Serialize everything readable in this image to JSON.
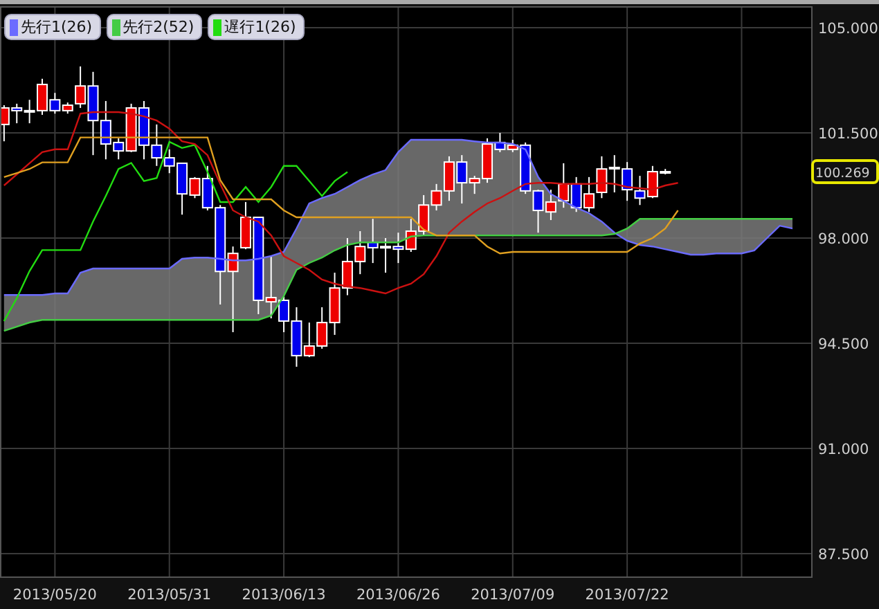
{
  "current_price": "100.269",
  "chart_data": {
    "type": "candlestick",
    "ylim": [
      86.72,
      105.69
    ],
    "categories": [
      null,
      null,
      null,
      null,
      "2013/05/20",
      null,
      null,
      null,
      null,
      null,
      null,
      null,
      null,
      "2013/05/31",
      null,
      null,
      null,
      null,
      null,
      null,
      null,
      null,
      "2013/06/13",
      null,
      null,
      null,
      null,
      null,
      null,
      null,
      null,
      "2013/06/26",
      null,
      null,
      null,
      null,
      null,
      null,
      null,
      null,
      "2013/07/09",
      null,
      null,
      null,
      null,
      null,
      null,
      null,
      null,
      "2013/07/22",
      null,
      null,
      null,
      null,
      null,
      null,
      null,
      null,
      null,
      null,
      null,
      null,
      null
    ],
    "grid": true,
    "yticks": [
      {
        "value": 105,
        "label": "105.000"
      },
      {
        "value": 101.5,
        "label": "101.500"
      },
      {
        "value": 98,
        "label": "98.000"
      },
      {
        "value": 94.5,
        "label": "94.500"
      },
      {
        "value": 91,
        "label": "91.000"
      },
      {
        "value": 87.5,
        "label": "87.500"
      }
    ],
    "series": [
      {
        "name": "先行1(26)",
        "type": "line",
        "color": "#6b6bff",
        "values": [
          96.11,
          96.11,
          96.11,
          96.11,
          96.16,
          96.16,
          96.85,
          96.99,
          96.99,
          96.99,
          96.99,
          96.99,
          96.99,
          96.99,
          97.31,
          97.35,
          97.35,
          97.31,
          97.26,
          97.26,
          97.31,
          97.4,
          97.54,
          98.32,
          99.15,
          99.33,
          99.47,
          99.7,
          99.93,
          100.12,
          100.26,
          100.86,
          101.27,
          101.27,
          101.27,
          101.27,
          101.27,
          101.22,
          101.18,
          101.18,
          101.13,
          100.95,
          100.03,
          99.47,
          99.24,
          99.01,
          98.83,
          98.55,
          98.18,
          97.91,
          97.77,
          97.72,
          97.63,
          97.54,
          97.45,
          97.45,
          97.49,
          97.49,
          97.49,
          97.59,
          98.0,
          98.41,
          98.32
        ]
      },
      {
        "name": "先行2(52)",
        "type": "line",
        "color": "#44cc44",
        "values": [
          94.91,
          95.05,
          95.19,
          95.28,
          95.28,
          95.28,
          95.28,
          95.28,
          95.28,
          95.28,
          95.28,
          95.28,
          95.28,
          95.28,
          95.28,
          95.28,
          95.28,
          95.28,
          95.28,
          95.28,
          95.28,
          95.42,
          96.07,
          96.94,
          97.17,
          97.35,
          97.59,
          97.77,
          97.86,
          97.86,
          97.86,
          97.86,
          98.05,
          98.09,
          98.09,
          98.09,
          98.09,
          98.09,
          98.09,
          98.09,
          98.09,
          98.09,
          98.09,
          98.09,
          98.09,
          98.09,
          98.09,
          98.09,
          98.14,
          98.32,
          98.64,
          98.64,
          98.64,
          98.64,
          98.64,
          98.64,
          98.64,
          98.64,
          98.64,
          98.64,
          98.64,
          98.64,
          98.64
        ]
      },
      {
        "name": "遅行1(26)",
        "type": "line",
        "color": "#22dd11",
        "values": [
          95.24,
          96.0,
          96.9,
          97.6,
          97.6,
          97.6,
          97.6,
          98.55,
          99.4,
          100.3,
          100.5,
          99.9,
          100.0,
          101.2,
          101.0,
          101.1,
          100.2,
          99.2,
          99.2,
          99.7,
          99.2,
          99.7,
          100.4,
          100.4,
          99.9,
          99.4,
          99.9,
          100.2,
          null,
          null,
          null,
          null,
          null,
          null,
          null,
          null,
          null,
          null,
          null,
          null,
          null,
          null,
          null,
          null,
          null,
          null,
          null,
          null,
          null,
          null,
          null,
          null,
          null,
          null,
          null,
          null,
          null,
          null,
          null,
          null,
          null,
          null,
          null
        ]
      },
      {
        "type": "line",
        "color": "#cc1111",
        "values": [
          99.75,
          100.12,
          100.49,
          100.86,
          100.95,
          100.95,
          102.14,
          102.19,
          102.19,
          102.19,
          102.14,
          102.05,
          101.91,
          101.64,
          101.22,
          101.13,
          100.76,
          99.8,
          98.92,
          98.69,
          98.55,
          98.09,
          97.4,
          97.17,
          96.94,
          96.62,
          96.48,
          96.39,
          96.34,
          96.25,
          96.16,
          96.34,
          96.48,
          96.8,
          97.4,
          98.18,
          98.55,
          98.87,
          99.15,
          99.33,
          99.57,
          99.8,
          99.84,
          99.84,
          99.8,
          99.8,
          99.8,
          99.84,
          99.8,
          99.7,
          99.66,
          99.61,
          99.75,
          99.84,
          null,
          null,
          null,
          null,
          null,
          null,
          null,
          null,
          null
        ]
      },
      {
        "type": "line",
        "color": "#e0a020",
        "values": [
          100.03,
          100.16,
          100.3,
          100.52,
          100.52,
          100.52,
          101.35,
          101.35,
          101.35,
          101.35,
          101.35,
          101.35,
          101.35,
          101.35,
          101.35,
          101.35,
          101.35,
          99.93,
          99.29,
          99.29,
          99.29,
          99.29,
          98.92,
          98.69,
          98.69,
          98.69,
          98.69,
          98.69,
          98.69,
          98.69,
          98.69,
          98.69,
          98.69,
          98.28,
          98.09,
          98.09,
          98.09,
          98.09,
          97.72,
          97.49,
          97.54,
          97.54,
          97.54,
          97.54,
          97.54,
          97.54,
          97.54,
          97.54,
          97.54,
          97.54,
          97.82,
          98.0,
          98.32,
          98.92,
          null,
          null,
          null,
          null,
          null,
          null,
          null,
          null,
          null
        ]
      }
    ],
    "ohlc": [
      [
        101.78,
        102.42,
        101.22,
        102.33
      ],
      [
        102.33,
        102.47,
        101.82,
        102.24
      ],
      [
        102.24,
        102.6,
        101.82,
        102.24
      ],
      [
        102.24,
        103.3,
        102.1,
        103.11
      ],
      [
        102.6,
        102.83,
        102.14,
        102.24
      ],
      [
        102.24,
        102.51,
        102.14,
        102.42
      ],
      [
        102.47,
        103.71,
        102.33,
        103.06
      ],
      [
        103.06,
        103.53,
        100.76,
        101.91
      ],
      [
        101.91,
        102.56,
        100.62,
        101.13
      ],
      [
        101.18,
        101.32,
        100.62,
        100.9
      ],
      [
        100.9,
        102.47,
        100.86,
        102.33
      ],
      [
        102.33,
        102.56,
        100.62,
        101.09
      ],
      [
        101.09,
        101.78,
        100.4,
        100.67
      ],
      [
        100.67,
        100.95,
        100.16,
        100.4
      ],
      [
        100.49,
        100.49,
        98.78,
        99.47
      ],
      [
        99.43,
        100.03,
        99.33,
        99.98
      ],
      [
        99.98,
        100.4,
        98.92,
        99.01
      ],
      [
        99.01,
        99.1,
        95.79,
        96.89
      ],
      [
        96.89,
        97.72,
        94.87,
        97.49
      ],
      [
        97.68,
        99.2,
        97.63,
        98.69
      ],
      [
        98.69,
        98.69,
        95.47,
        95.93
      ],
      [
        95.88,
        97.4,
        95.33,
        96.02
      ],
      [
        95.93,
        96.07,
        94.87,
        95.24
      ],
      [
        95.24,
        95.7,
        93.72,
        94.09
      ],
      [
        94.09,
        95.19,
        94.04,
        94.41
      ],
      [
        94.41,
        95.7,
        94.32,
        95.19
      ],
      [
        95.19,
        96.85,
        94.78,
        96.34
      ],
      [
        96.34,
        98.0,
        96.1,
        97.22
      ],
      [
        97.22,
        98.23,
        96.8,
        97.72
      ],
      [
        97.86,
        98.64,
        97.17,
        97.68
      ],
      [
        97.68,
        98.0,
        96.85,
        97.72
      ],
      [
        97.72,
        98.18,
        97.17,
        97.63
      ],
      [
        97.63,
        98.64,
        97.54,
        98.23
      ],
      [
        98.23,
        99.43,
        98.09,
        99.1
      ],
      [
        99.1,
        99.8,
        98.92,
        99.57
      ],
      [
        99.57,
        100.72,
        99.24,
        100.53
      ],
      [
        100.53,
        100.76,
        99.15,
        99.84
      ],
      [
        99.84,
        100.07,
        99.47,
        99.98
      ],
      [
        99.98,
        101.32,
        99.84,
        101.13
      ],
      [
        101.18,
        101.5,
        100.86,
        100.95
      ],
      [
        100.95,
        101.27,
        100.86,
        101.09
      ],
      [
        101.09,
        101.18,
        99.47,
        99.57
      ],
      [
        99.57,
        99.61,
        98.18,
        98.92
      ],
      [
        98.87,
        99.61,
        98.6,
        99.2
      ],
      [
        99.24,
        100.49,
        99.01,
        99.8
      ],
      [
        99.8,
        100.03,
        98.87,
        99.01
      ],
      [
        99.01,
        100.03,
        98.87,
        99.47
      ],
      [
        99.52,
        100.72,
        99.33,
        100.3
      ],
      [
        100.35,
        100.76,
        99.52,
        100.35
      ],
      [
        100.3,
        100.53,
        99.24,
        99.61
      ],
      [
        99.57,
        100.07,
        99.1,
        99.33
      ],
      [
        99.38,
        100.4,
        99.33,
        100.21
      ],
      [
        100.21,
        100.3,
        100.12,
        100.21
      ],
      null,
      null,
      null,
      null,
      null,
      null,
      null,
      null,
      null,
      null
    ]
  }
}
